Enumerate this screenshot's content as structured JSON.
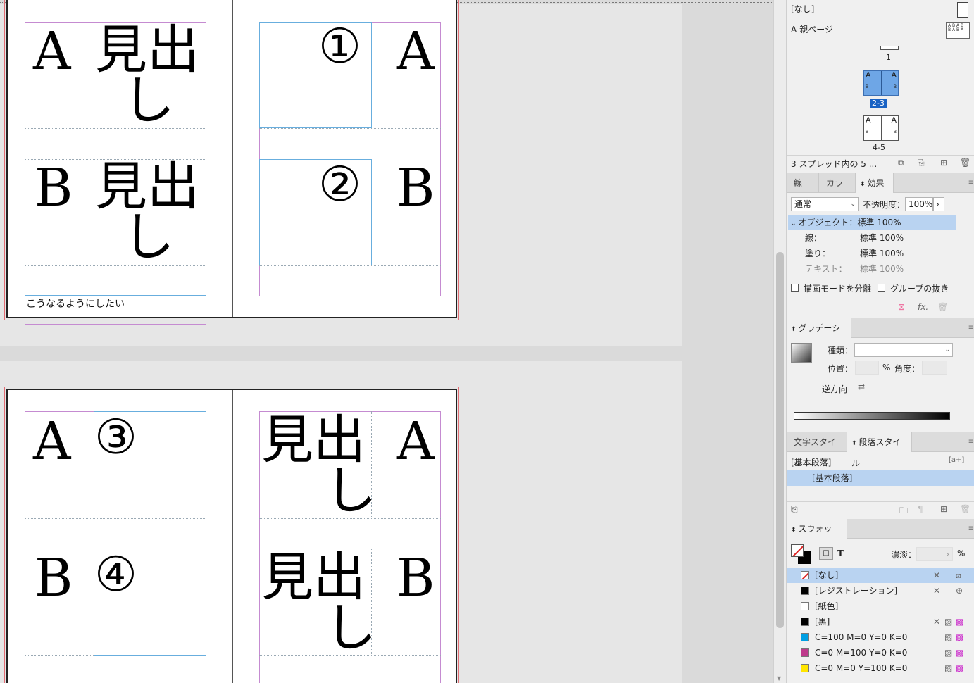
{
  "canvas": {
    "spread_top": {
      "left_page": {
        "rows": [
          {
            "letter": "A",
            "heading_line1": "見出",
            "heading_line2": "し"
          },
          {
            "letter": "B",
            "heading_line1": "見出",
            "heading_line2": "し"
          }
        ],
        "note": "こうなるようにしたい"
      },
      "right_page": {
        "rows": [
          {
            "number": "①",
            "letter": "A"
          },
          {
            "number": "②",
            "letter": "B"
          }
        ]
      }
    },
    "spread_bottom": {
      "left_page": {
        "rows": [
          {
            "letter": "A",
            "number": "③"
          },
          {
            "letter": "B",
            "number": "④"
          }
        ]
      },
      "right_page": {
        "rows": [
          {
            "heading_line1": "見出",
            "heading_line2": "し",
            "letter": "A"
          },
          {
            "heading_line1": "見出",
            "heading_line2": "し",
            "letter": "B"
          }
        ]
      }
    }
  },
  "pages_panel": {
    "none_master": "[なし]",
    "a_master": "A-親ページ",
    "page_1": "1",
    "spread_2_3": "2-3",
    "spread_4_5": "4-5",
    "status": "3 スプレッド内の 5 ..."
  },
  "effects_panel": {
    "tabs": [
      "線",
      "カラー",
      "効果"
    ],
    "blend_mode": "通常",
    "opacity_label": "不透明度：",
    "opacity_value": "100%",
    "object_row": "オブジェクト：標準 100%",
    "stroke_label": "線：",
    "stroke_value": "標準 100%",
    "fill_label": "塗り：",
    "fill_value": "標準 100%",
    "text_label": "テキスト：",
    "text_value": "標準 100%",
    "isolate_blending": "描画モードを分離",
    "knockout_group": "グループの抜き",
    "fx_label": "fx."
  },
  "gradient_panel": {
    "tab": "グラデーション",
    "type_label": "種類：",
    "type_value": "",
    "location_label": "位置：",
    "percent": "%",
    "angle_label": "角度：",
    "reverse_label": "逆方向"
  },
  "styles_panel": {
    "tabs": [
      "文字スタイル",
      "段落スタイル"
    ],
    "header_item": "[基本段落]",
    "new_style_badge": "[a+]",
    "selected_item": "[基本段落]"
  },
  "swatches_panel": {
    "tab": "スウォッチ",
    "tint_label": "濃淡：",
    "tint_unit": "%",
    "t_label": "T",
    "items": [
      {
        "name": "[なし]",
        "color": "#ffffff"
      },
      {
        "name": "[レジストレーション]",
        "color": "#000000"
      },
      {
        "name": "[紙色]",
        "color": "#ffffff"
      },
      {
        "name": "[黒]",
        "color": "#000000"
      },
      {
        "name": "C=100 M=0 Y=0 K=0",
        "color": "#009fe3"
      },
      {
        "name": "C=0 M=100 Y=0 K=0",
        "color": "#be3a8c"
      },
      {
        "name": "C=0 M=0 Y=100 K=0",
        "color": "#ffe500"
      }
    ]
  }
}
